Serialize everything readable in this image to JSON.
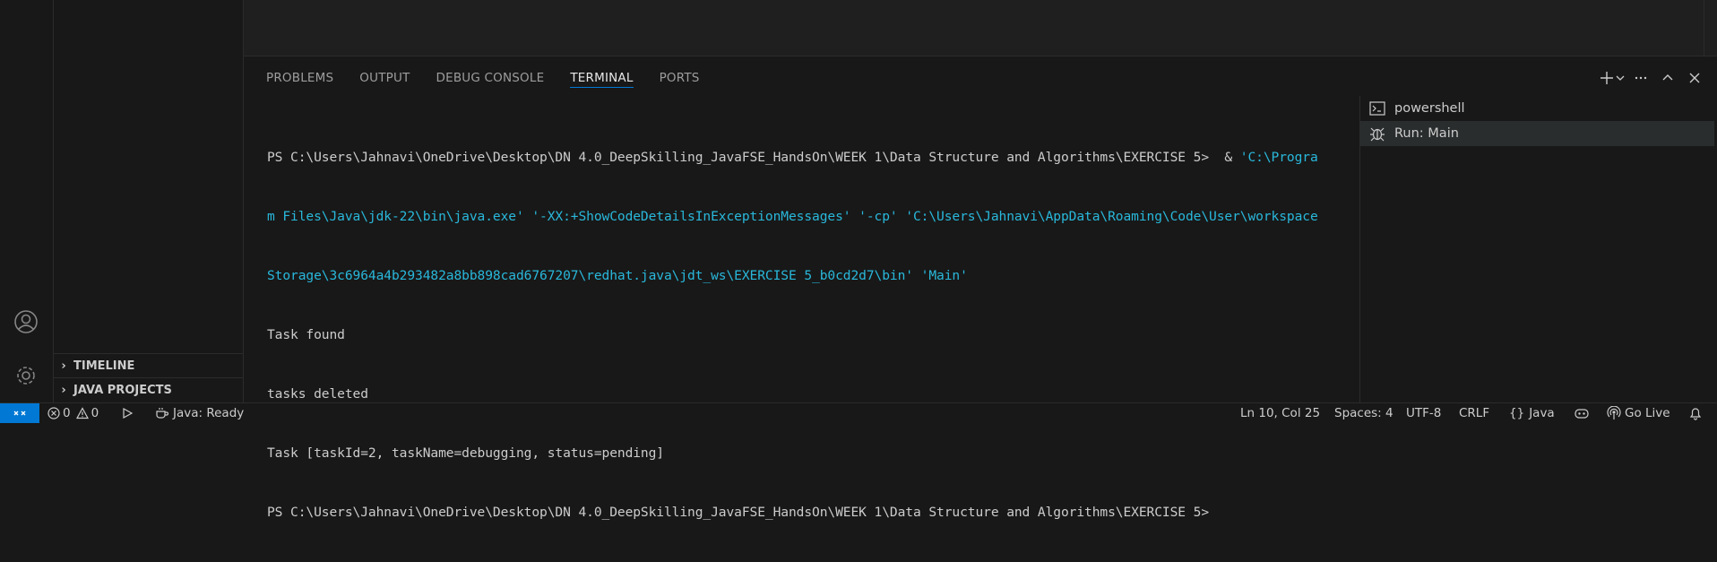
{
  "sidebar": {
    "timeline_label": "TIMELINE",
    "java_projects_label": "JAVA PROJECTS"
  },
  "panel": {
    "tabs": [
      {
        "label": "PROBLEMS"
      },
      {
        "label": "OUTPUT"
      },
      {
        "label": "DEBUG CONSOLE"
      },
      {
        "label": "TERMINAL"
      },
      {
        "label": "PORTS"
      }
    ],
    "active_tab": "TERMINAL"
  },
  "terminal": {
    "line1_prompt": "PS C:\\Users\\Jahnavi\\OneDrive\\Desktop\\DN 4.0_DeepSkilling_JavaFSE_HandsOn\\WEEK 1\\Data Structure and Algorithms\\EXERCISE 5>  & ",
    "line1_cmd": "'C:\\Progra",
    "line2": "m Files\\Java\\jdk-22\\bin\\java.exe' '-XX:+ShowCodeDetailsInExceptionMessages' '-cp' 'C:\\Users\\Jahnavi\\AppData\\Roaming\\Code\\User\\workspace",
    "line3": "Storage\\3c6964a4b293482a8bb898cad6767207\\redhat.java\\jdt_ws\\EXERCISE 5_b0cd2d7\\bin' 'Main'",
    "output": [
      "Task found",
      "tasks deleted",
      "Task [taskId=2, taskName=debugging, status=pending]"
    ],
    "final_prompt": "PS C:\\Users\\Jahnavi\\OneDrive\\Desktop\\DN 4.0_DeepSkilling_JavaFSE_HandsOn\\WEEK 1\\Data Structure and Algorithms\\EXERCISE 5>"
  },
  "terminal_list": [
    {
      "label": "powershell",
      "icon": "terminal-icon"
    },
    {
      "label": "Run: Main",
      "icon": "debug-icon"
    }
  ],
  "statusbar": {
    "errors": "0",
    "warnings": "0",
    "java_status": "Java: Ready",
    "cursor": "Ln 10, Col 25",
    "spaces": "Spaces: 4",
    "encoding": "UTF-8",
    "eol": "CRLF",
    "language": "Java",
    "golive": "Go Live"
  },
  "colors": {
    "accent": "#0078d4",
    "terminal_cyan": "#29b8db"
  }
}
